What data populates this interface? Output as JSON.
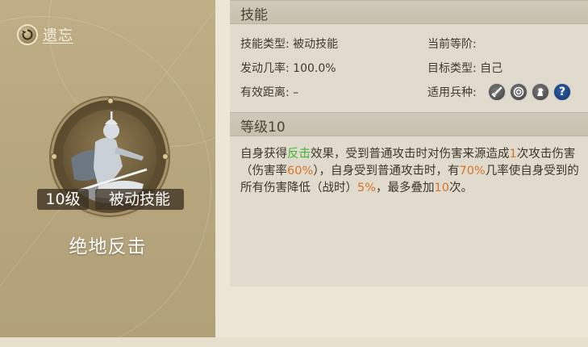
{
  "forget": {
    "label": "遗忘",
    "icon": "undo-icon"
  },
  "skill_card": {
    "level": "10级",
    "type": "被动技能",
    "name": "绝地反击",
    "portrait_icon": "spearman-portrait"
  },
  "skill_section": {
    "title": "技能",
    "type_label": "技能类型:",
    "type_value": "被动技能",
    "rank_label": "当前等阶:",
    "rate_label": "发动几率:",
    "rate_value": "100.0%",
    "target_label": "目标类型:",
    "target_value": "自己",
    "range_label": "有效距离:",
    "range_value": "–",
    "units_label": "适用兵种:",
    "units": [
      "sword-unit-icon",
      "bow-unit-icon",
      "cavalry-unit-icon",
      "question-icon"
    ],
    "question_glyph": "?"
  },
  "level_section": {
    "title": "等级10",
    "desc": {
      "p1": "自身获得",
      "h1": "反击",
      "p2": "效果，受到普通攻击时对伤害来源造成",
      "h2": "1",
      "p3": "次攻击伤害（伤害率",
      "h3": "60%",
      "p4": "），自身受到普通攻击时，有",
      "h4": "70%",
      "p5": "几率使自身受到的所有伤害降低（战时）",
      "h5": "5%",
      "p6": "，最多叠加",
      "h6": "10",
      "p7": "次。"
    }
  },
  "colors": {
    "highlight_green": "#46b43a",
    "highlight_orange": "#d8742a",
    "card_bg": "#b8a77f"
  }
}
